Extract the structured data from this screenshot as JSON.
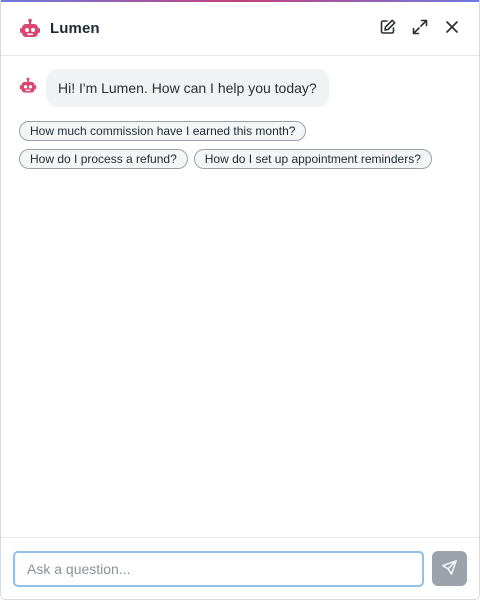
{
  "colors": {
    "accent_bar": "#c2417a",
    "brand_icon": "#d9466f",
    "input_focus_border": "#8ec0ea",
    "send_button_bg": "#9da3ab"
  },
  "header": {
    "icon": "robot-icon",
    "title": "Lumen",
    "actions": [
      {
        "icon": "edit-icon"
      },
      {
        "icon": "expand-icon"
      },
      {
        "icon": "close-icon"
      }
    ]
  },
  "messages": [
    {
      "sender": "bot",
      "avatar_icon": "robot-icon",
      "text": "Hi! I'm Lumen. How can I help you today?"
    }
  ],
  "suggestions": [
    "How much commission have I earned this month?",
    "How do I process a refund?",
    "How do I set up appointment reminders?"
  ],
  "composer": {
    "placeholder": "Ask a question...",
    "value": "",
    "send_icon": "send-icon"
  }
}
